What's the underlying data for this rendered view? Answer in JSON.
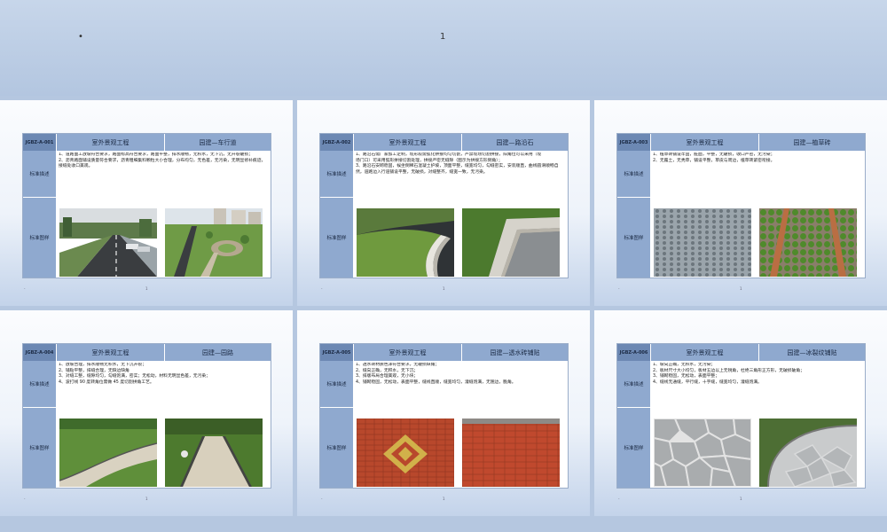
{
  "top": {
    "dot": "•",
    "page_number": "1"
  },
  "slides": [
    {
      "code": "JGBZ-A-001",
      "title": "室外景观工程",
      "subtitle": "园建—车行道",
      "label_desc": "标准描述",
      "label_pic": "标准图样",
      "desc": [
        "1、道路面工放坡符合要求，路面标高符合要求，路面平整，排水顺畅，无积水，无下沉，无开裂破损；",
        "2、沥青路面铺设质量符合要求，沥青粗细集料颗粒大小合理，分布均匀，无色差，无污染，无明显修补痕迹，接缝处收口美观。"
      ],
      "footer_left": "-",
      "footer_center": "1"
    },
    {
      "code": "JGBZ-A-002",
      "title": "室外景观工程",
      "subtitle": "园建—路沿石",
      "label_desc": "标准描述",
      "label_pic": "标准图样",
      "desc": [
        "1、路沿石需厂家加工定制，现形段需弧化拼接均匀切割，严禁现场切割拼接，阳角位可以采用（现",
        "场门口）可采用弧形拼接切割处理，拼接严密无缝隙（图示为拼接方形倒角）；",
        "3、路沿石安砌稳固，候坐倒稀石混凝土护坡，顶面平整，缝宽均匀，勾缝密实，安装顺直，曲线圆滑顺畅自然，道路边入行道铺设平整，无破损，对缝整齐，缝宽一致，无污染。"
      ],
      "footer_left": "-",
      "footer_center": "1"
    },
    {
      "code": "JGBZ-A-003",
      "title": "室外景观工程",
      "subtitle": "园建—植草砖",
      "label_desc": "标准描述",
      "label_pic": "标准图样",
      "desc": [
        "1、植草砖铺设牢固，脏面，平整，无破损，收口严密，无污染；",
        "2、无露土，无秃草，铺设平整，草皮与周边，植草砖紧密衔接。"
      ],
      "footer_left": "-",
      "footer_center": "1"
    },
    {
      "code": "JGBZ-A-004",
      "title": "室外景观工程",
      "subtitle": "园建—园路",
      "label_desc": "标准描述",
      "label_pic": "标准图样",
      "desc": [
        "1、放坡合理，排水顺畅无积水，无下沉开裂；",
        "2、铺贴平整，排缝合理，无缺边缺角",
        "3、对缝工整，缝隙均匀，勾缝饱满，密实；无松动，材料无明显色差，无污染；",
        "4、波打线 90 度转角位需做 45 度切割拼角工艺。"
      ],
      "footer_left": "-",
      "footer_center": "1"
    },
    {
      "code": "JGBZ-A-005",
      "title": "室外景观工程",
      "subtitle": "园建—透水砖铺贴",
      "label_desc": "标准描述",
      "label_pic": "标准图样",
      "desc": [
        "1、透水砖材质色泽符合要求，无破损缺角；",
        "2、缝向正确，无积水，无下沉；",
        "3、排版布局合理美观，无小块；",
        "4、铺砌稳固，无松动，表面平整，缝线直顺，缝宽均匀，灌缝饱满，无翘边，脆角。"
      ],
      "footer_left": "-",
      "footer_center": "1"
    },
    {
      "code": "JGBZ-A-006",
      "title": "室外景观工程",
      "subtitle": "园建—冰裂纹铺贴",
      "label_desc": "标准描述",
      "label_pic": "标准图样",
      "desc": [
        "1、坡向正确，无积水，无污染；",
        "2、板材尺寸大小均匀，板材五边以上无锐角，杜绝三角形正方形，无破损破角；",
        "3、铺砌稳固，无松动，表面平整；",
        "4、缝线无通缝，平行缝，十字缝，缝宽均匀，灌缝饱满。"
      ],
      "footer_left": "-",
      "footer_center": "1"
    }
  ],
  "colors": {
    "header": "#8fa9cf",
    "code_cell": "#6c88b3",
    "background": "#b5c7e0"
  }
}
